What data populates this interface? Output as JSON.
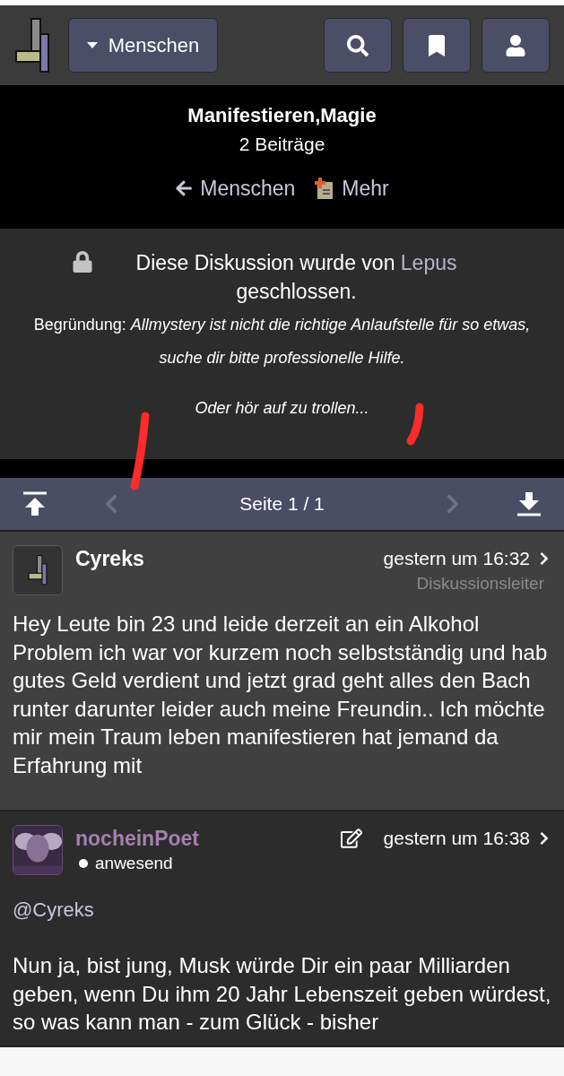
{
  "header": {
    "category_button": "Menschen"
  },
  "thread": {
    "title": "Manifestieren,Magie",
    "post_count": "2 Beiträge",
    "back_link": "Menschen",
    "more_link": "Mehr"
  },
  "closed_notice": {
    "prefix": "Diese Diskussion wurde von",
    "closer": "Lepus",
    "suffix": "geschlossen.",
    "reason_label": "Begründung:",
    "reason": "Allmystery ist nicht die richtige Anlaufstelle für so etwas, suche dir bitte professionelle Hilfe.",
    "reason_extra": "Oder hör auf zu trollen..."
  },
  "pagination": {
    "label": "Seite 1 / 1",
    "prev_disabled": true,
    "next_disabled": true
  },
  "posts": [
    {
      "author": "Cyreks",
      "avatar": {
        "kind": "logo"
      },
      "time": "gestern um 16:32",
      "role": "Diskussionsleiter",
      "edited": false,
      "body": [
        "Hey Leute bin 23 und leide derzeit an ein Alkohol Problem ich war vor kurzem noch selbstständig und hab gutes Geld verdient und jetzt grad geht alles den Bach runter darunter leider auch meine Freundin.. Ich möchte mir mein Traum leben manifestieren hat jemand da Erfahrung mit"
      ]
    },
    {
      "author": "nocheinPoet",
      "avatar": {
        "kind": "picture"
      },
      "status": "anwesend",
      "time": "gestern um 16:38",
      "edited": true,
      "mention": "@Cyreks",
      "body": [
        "Nun ja, bist jung, Musk würde Dir ein paar Milliarden geben, wenn Du ihm 20 Jahr Lebenszeit geben würdest, so was kann man - zum Glück - bisher"
      ]
    }
  ]
}
